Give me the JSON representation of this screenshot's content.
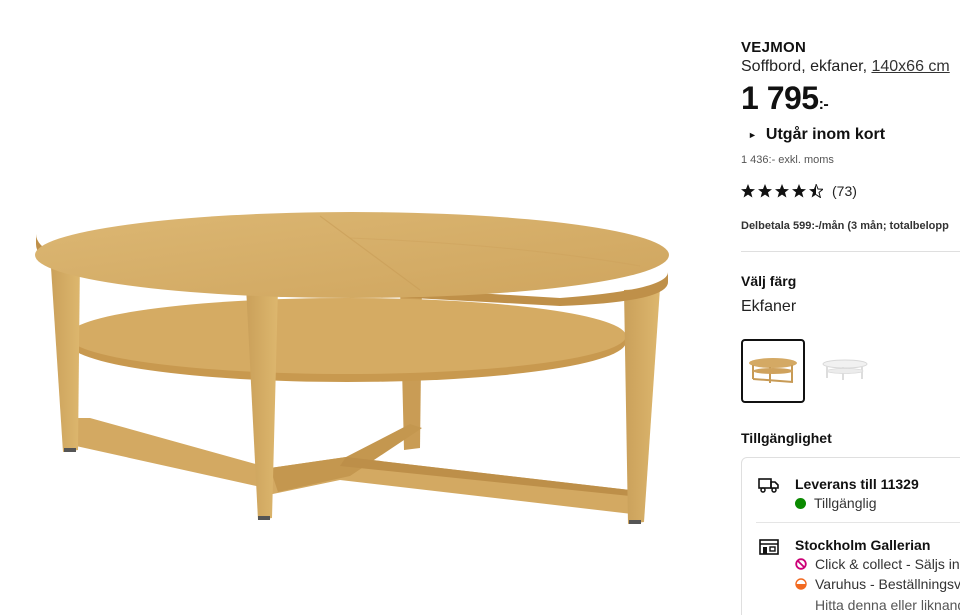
{
  "product": {
    "name": "VEJMON",
    "description": "Soffbord, ekfaner,",
    "dimensions": "140x66 cm",
    "price": "1 795",
    "price_suffix": ":-",
    "notice": "Utgår inom kort",
    "excl_vat": "1 436:- exkl. moms",
    "rating": {
      "stars": 4.5,
      "max": 5,
      "count": "(73)"
    },
    "installment": "Delbetala 599:-/mån (3 mån; totalbelopp"
  },
  "color": {
    "heading": "Välj färg",
    "selected": "Ekfaner",
    "options": [
      "oak-veneer-swatch",
      "white-swatch"
    ]
  },
  "availability": {
    "heading": "Tillgänglighet",
    "delivery": {
      "title": "Leverans till 11329",
      "status": "Tillgänglig",
      "icon": "truck-icon",
      "status_color": "#0a8a00"
    },
    "store": {
      "title": "Stockholm Gallerian",
      "icon": "store-icon",
      "line1": "Click & collect - Säljs inte",
      "line1_color": "#cc0077",
      "line2": "Varuhus - Beställningsvara",
      "line2_color": "#f26a21",
      "line3": "Hitta denna eller liknande"
    }
  },
  "colors": {
    "oak": "#d8b26a",
    "text": "#111111",
    "border": "#dfdfdf"
  }
}
